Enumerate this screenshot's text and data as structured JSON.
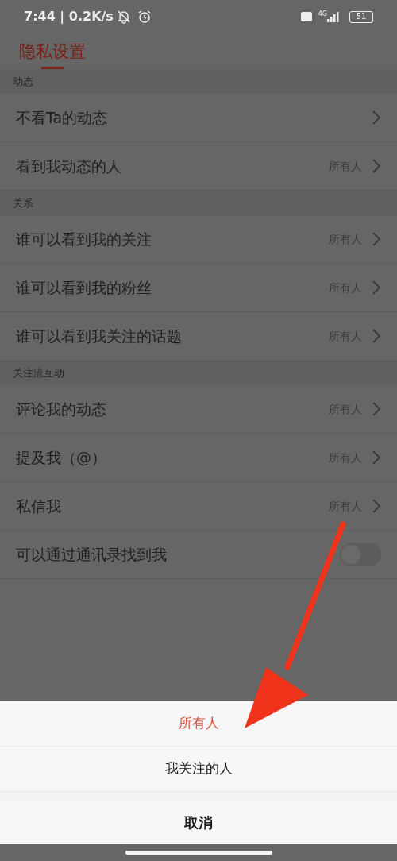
{
  "status_bar": {
    "time": "7:44 | 0.2K/s",
    "network": "4G",
    "battery": "51"
  },
  "header": {
    "title": "隐私设置"
  },
  "sections": [
    {
      "title": "动态",
      "rows": [
        {
          "kind": "link",
          "label": "不看Ta的动态"
        },
        {
          "kind": "link",
          "label": "看到我动态的人",
          "value": "所有人"
        }
      ]
    },
    {
      "title": "关系",
      "rows": [
        {
          "kind": "link",
          "label": "谁可以看到我的关注",
          "value": "所有人"
        },
        {
          "kind": "link",
          "label": "谁可以看到我的粉丝",
          "value": "所有人"
        },
        {
          "kind": "link",
          "label": "谁可以看到我关注的话题",
          "value": "所有人"
        }
      ]
    },
    {
      "title": "关注流互动",
      "rows": [
        {
          "kind": "link",
          "label": "评论我的动态",
          "value": "所有人"
        },
        {
          "kind": "link",
          "label": "提及我（@）",
          "value": "所有人"
        },
        {
          "kind": "link",
          "label": "私信我",
          "value": "所有人"
        },
        {
          "kind": "toggle",
          "label": "可以通过通讯录找到我",
          "on": false
        }
      ]
    }
  ],
  "sheet": {
    "options": [
      {
        "label": "所有人",
        "selected": true
      },
      {
        "label": "我关注的人",
        "selected": false
      }
    ],
    "cancel": "取消"
  }
}
